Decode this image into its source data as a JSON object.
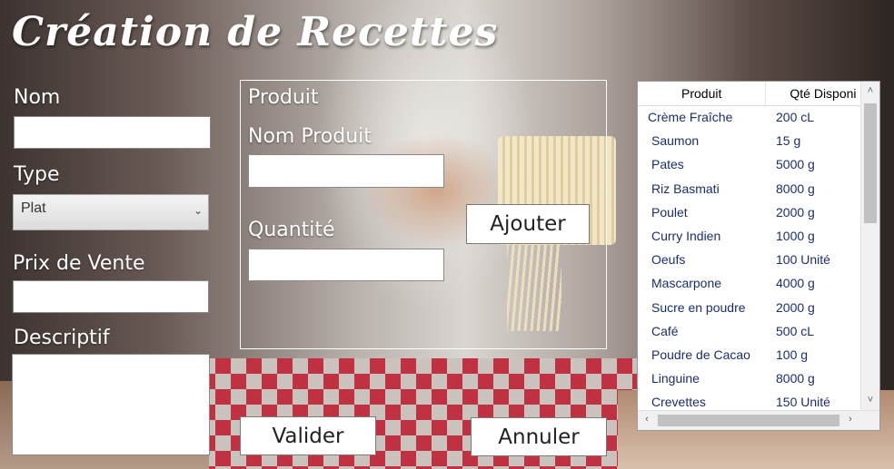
{
  "window": {
    "title": "Création de Recettes"
  },
  "form": {
    "nom_label": "Nom",
    "nom_value": "",
    "type_label": "Type",
    "type_selected": "Plat",
    "prix_label": "Prix de Vente",
    "prix_value": "",
    "descriptif_label": "Descriptif",
    "descriptif_value": ""
  },
  "produit_group": {
    "title": "Produit",
    "nom_produit_label": "Nom Produit",
    "nom_produit_value": "",
    "quantite_label": "Quantité",
    "quantite_value": "",
    "ajouter_label": "Ajouter"
  },
  "actions": {
    "valider_label": "Valider",
    "annuler_label": "Annuler"
  },
  "grid": {
    "columns": [
      "Produit",
      "Qté Disponi"
    ],
    "rows": [
      {
        "produit": "Crème Fraîche",
        "qte": "200  cL"
      },
      {
        "produit": "Saumon",
        "qte": "15  g"
      },
      {
        "produit": "Pates",
        "qte": "5000  g"
      },
      {
        "produit": "Riz Basmati",
        "qte": "8000  g"
      },
      {
        "produit": "Poulet",
        "qte": "2000  g"
      },
      {
        "produit": "Curry Indien",
        "qte": "1000  g"
      },
      {
        "produit": "Oeufs",
        "qte": "100  Unité"
      },
      {
        "produit": "Mascarpone",
        "qte": "4000  g"
      },
      {
        "produit": "Sucre en poudre",
        "qte": "2000  g"
      },
      {
        "produit": "Café",
        "qte": "500  cL"
      },
      {
        "produit": "Poudre de Cacao",
        "qte": "100  g"
      },
      {
        "produit": "Linguine",
        "qte": "8000  g"
      },
      {
        "produit": "Crevettes",
        "qte": "150  Unité"
      }
    ]
  }
}
